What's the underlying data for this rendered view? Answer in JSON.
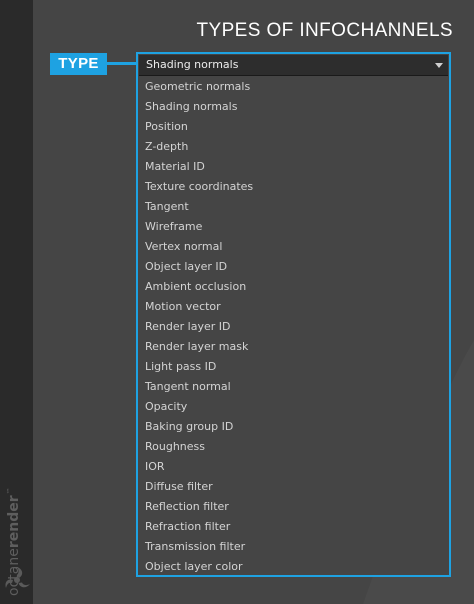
{
  "branding": {
    "name_part1": "octane",
    "name_part2": "render",
    "trademark": "™"
  },
  "heading": "TYPES OF INFOCHANNELS",
  "type_label": "TYPE",
  "dropdown": {
    "selected": "Shading normals",
    "options": [
      "Geometric normals",
      "Shading normals",
      "Position",
      "Z-depth",
      "Material ID",
      "Texture coordinates",
      "Tangent",
      "Wireframe",
      "Vertex normal",
      "Object layer ID",
      "Ambient occlusion",
      "Motion vector",
      "Render layer ID",
      "Render layer mask",
      "Light pass ID",
      "Tangent normal",
      "Opacity",
      "Baking group ID",
      "Roughness",
      "IOR",
      "Diffuse filter",
      "Reflection filter",
      "Refraction filter",
      "Transmission filter",
      "Object layer color"
    ]
  },
  "colors": {
    "accent": "#1ea2e2",
    "background": "#454545",
    "side_strip": "#2a2a2a"
  }
}
